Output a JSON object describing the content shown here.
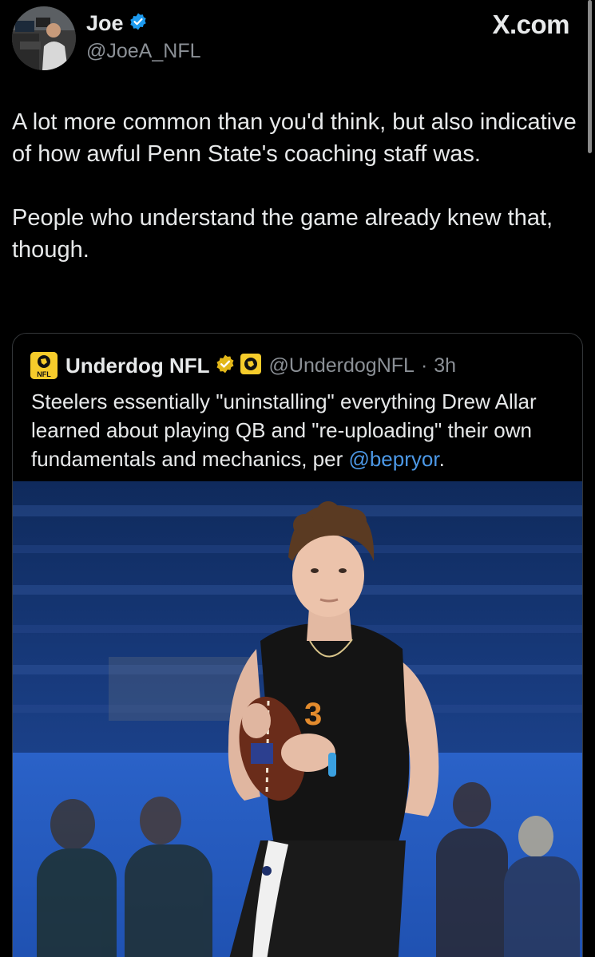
{
  "header": {
    "author_name": "Joe",
    "author_handle": "@JoeA_NFL",
    "site_label": "X.com"
  },
  "tweet": {
    "paragraphs": [
      "A lot more common than you'd think, but also indicative of how awful Penn State's coaching staff was.",
      "People who understand the game already knew that, though."
    ]
  },
  "quote": {
    "author_name": "Underdog NFL",
    "author_handle": "@UnderdogNFL",
    "separator": "·",
    "time": "3h",
    "logo_text": "NFL",
    "text_before_mention": "Steelers essentially \"uninstalling\" everything Drew Allar learned about playing QB and \"re-uploading\" their own fundamentals and mechanics, per ",
    "mention": "@bepryor",
    "text_after_mention": "."
  },
  "colors": {
    "background": "#000000",
    "text": "#e7e9ea",
    "secondary": "#8b9096",
    "link": "#4c98e6",
    "verified_blue": "#1d9bf0",
    "verified_gold": "#e2b719",
    "underdog_yellow": "#f6cc2b"
  },
  "icons": {
    "verified_blue": "verified-badge-icon",
    "verified_gold": "gold-verified-badge-icon",
    "affiliate": "underdog-affiliate-icon"
  }
}
